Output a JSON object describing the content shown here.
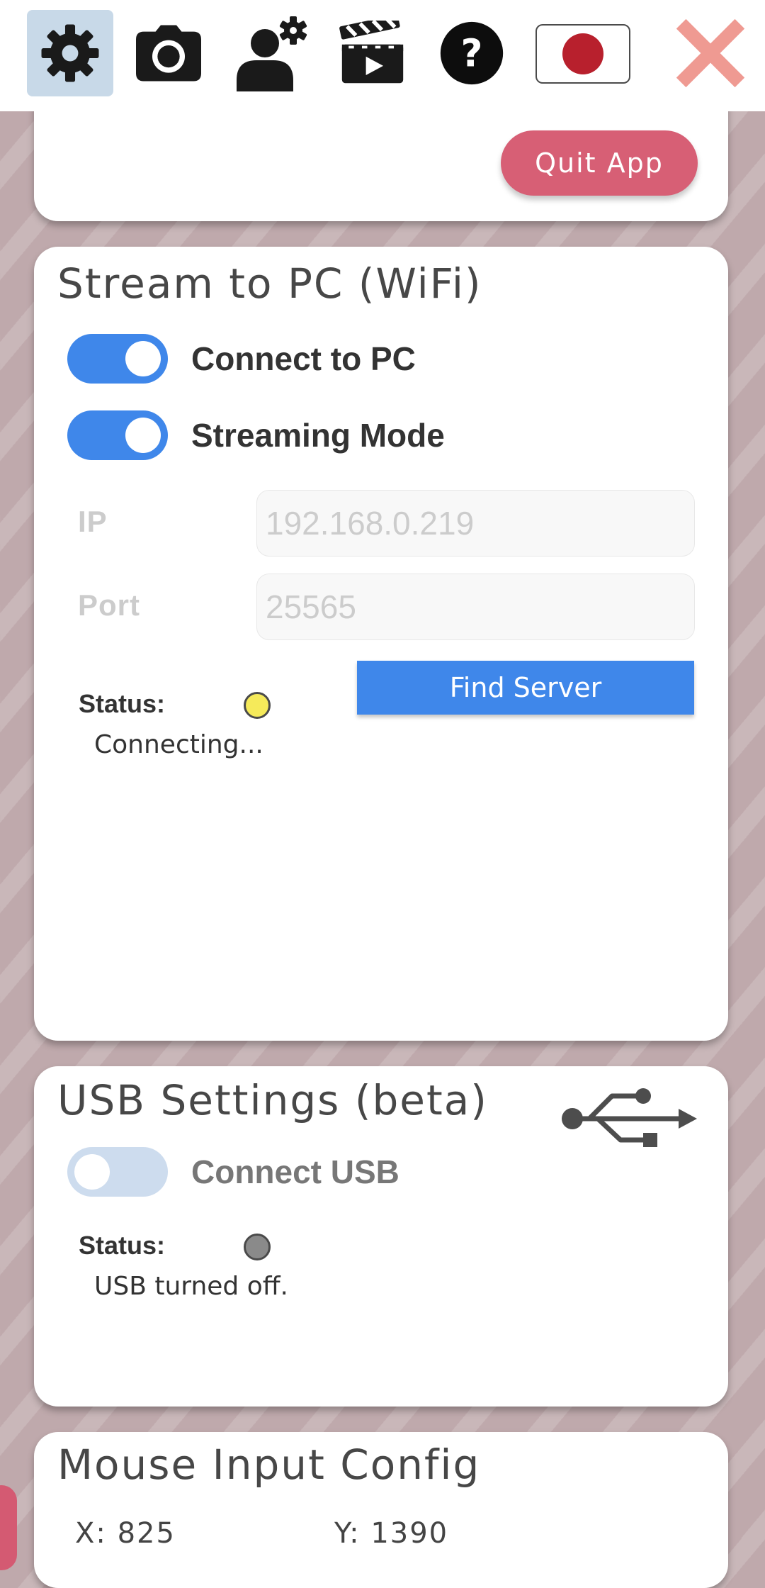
{
  "toolbar": {
    "items": [
      {
        "icon": "gear-icon",
        "active": true
      },
      {
        "icon": "camera-icon",
        "active": false
      },
      {
        "icon": "user-settings-icon",
        "active": false
      },
      {
        "icon": "clapperboard-icon",
        "active": false
      },
      {
        "icon": "help-icon",
        "active": false
      },
      {
        "icon": "japan-flag-icon",
        "active": false
      },
      {
        "icon": "close-icon",
        "active": false
      }
    ],
    "accent_color": "#c8d9e8",
    "close_color": "#ef9a92"
  },
  "app_panel": {
    "quit_label": "Quit App",
    "quit_color": "#d75f75"
  },
  "stream_panel": {
    "title": "Stream to PC (WiFi)",
    "connect_toggle": {
      "label": "Connect to PC",
      "on": true
    },
    "streaming_toggle": {
      "label": "Streaming Mode",
      "on": true
    },
    "ip": {
      "label": "IP",
      "value": "192.168.0.219"
    },
    "port": {
      "label": "Port",
      "value": "25565"
    },
    "find_server_label": "Find Server",
    "status_label": "Status:",
    "status_text": "Connecting...",
    "status_color": "#f5ea5a"
  },
  "usb_panel": {
    "title": "USB Settings (beta)",
    "icon": "usb-icon",
    "connect_toggle": {
      "label": "Connect USB",
      "on": false
    },
    "status_label": "Status:",
    "status_text": "USB turned off.",
    "status_color": "#8a8a8a"
  },
  "mouse_panel": {
    "title": "Mouse Input Config",
    "x_label": "X:",
    "x_value": "825",
    "y_label": "Y:",
    "y_value": "1390"
  },
  "colors": {
    "toggle_on": "#3f87ea",
    "toggle_off": "#cddcee",
    "button_blue": "#3f87ea"
  }
}
